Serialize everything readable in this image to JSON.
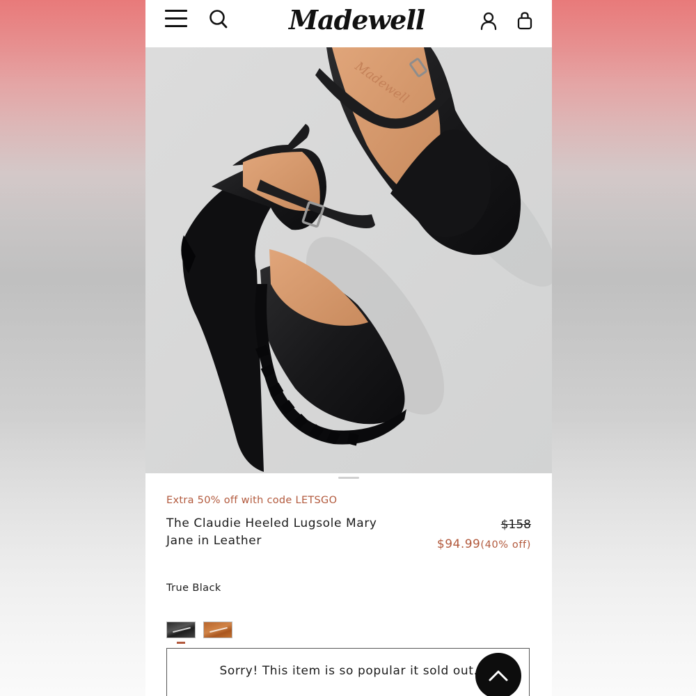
{
  "header": {
    "logo_text": "Madewell",
    "icons": [
      "menu-icon",
      "search-icon",
      "account-icon",
      "bag-icon"
    ]
  },
  "promo": {
    "text": "Extra 50% off with code LETSGO"
  },
  "product": {
    "name": "The Claudie Heeled Lugsole Mary Jane in Leather",
    "original_price": "$158",
    "sale_price": "$94.99",
    "discount": "(40% off)",
    "color_name": "True Black",
    "swatches": [
      "True Black",
      "Tan"
    ]
  },
  "status": {
    "sold_out_message": "Sorry! This item is so popular it sold out."
  },
  "colors": {
    "accent": "#b2593c",
    "text": "#1a1a1a",
    "image_bg": "#d8d9d9"
  }
}
